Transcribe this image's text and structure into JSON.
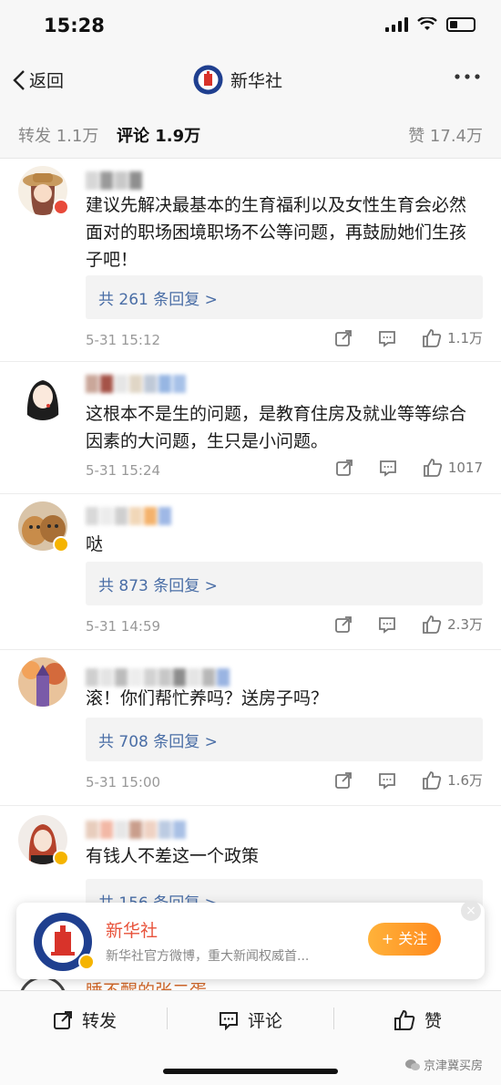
{
  "status": {
    "time": "15:28"
  },
  "nav": {
    "back_label": "返回",
    "title": "新华社"
  },
  "tabs": {
    "repost": "转发 1.1万",
    "comment": "评论 1.9万",
    "like": "赞 17.4万"
  },
  "comments": [
    {
      "text": "建议先解决最基本的生育福利以及女性生育会必然面对的职场困境职场不公等问题，再鼓励她们生孩子吧！",
      "reply_link": "共 261 条回复 >",
      "time": "5-31 15:12",
      "likes": "1.1万"
    },
    {
      "text": "这根本不是生的问题，是教育住房及就业等等综合因素的大问题，生只是小问题。",
      "time": "5-31 15:24",
      "likes": "1017"
    },
    {
      "text": "哒",
      "reply_link": "共 873 条回复 >",
      "time": "5-31 14:59",
      "likes": "2.3万"
    },
    {
      "text": "滚！你们帮忙养吗？送房子吗？",
      "reply_link": "共 708 条回复 >",
      "time": "5-31 15:00",
      "likes": "1.6万"
    },
    {
      "text": "有钱人不差这一个政策",
      "reply_link": "共 156 条回复 >"
    },
    {
      "username": "睡不醒的张二蛋"
    }
  ],
  "follow_card": {
    "name": "新华社",
    "desc": "新华社官方微博，重大新闻权威首...",
    "button": "+ 关注",
    "close": "×"
  },
  "bottom_bar": {
    "repost": "转发",
    "comment": "评论",
    "like": "赞"
  },
  "watermark": "京津冀买房",
  "colors": {
    "accent": "#e8523a",
    "link": "#4a6ea6",
    "follow_button": "#ff9a2a",
    "username": "#d2692b"
  }
}
